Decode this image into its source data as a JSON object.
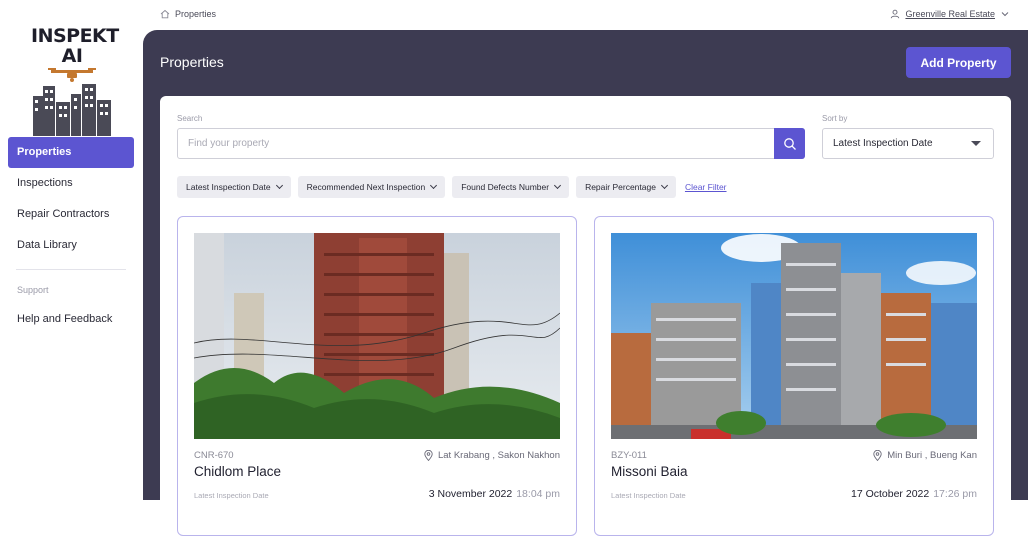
{
  "app": {
    "logo_text": "INSPEKT AI"
  },
  "sidebar": {
    "items": [
      {
        "label": "Properties"
      },
      {
        "label": "Inspections"
      },
      {
        "label": "Repair Contractors"
      },
      {
        "label": "Data Library"
      }
    ],
    "support_heading": "Support",
    "support_items": [
      {
        "label": "Help and Feedback"
      }
    ]
  },
  "topbar": {
    "breadcrumb": "Properties",
    "account_name": "Greenville Real Estate"
  },
  "main": {
    "title": "Properties",
    "add_button": "Add Property",
    "search": {
      "label": "Search",
      "placeholder": "Find your property",
      "value": ""
    },
    "sort": {
      "label": "Sort by",
      "value": "Latest Inspection Date"
    },
    "filters": [
      "Latest Inspection Date",
      "Recommended Next Inspection",
      "Found Defects Number",
      "Repair Percentage"
    ],
    "clear_filter": "Clear Filter",
    "properties": [
      {
        "code": "CNR-670",
        "location": "Lat Krabang , Sakon Nakhon",
        "name": "Chidlom Place",
        "inspection_label": "Latest Inspection Date",
        "inspection_date": "3 November 2022",
        "inspection_time": "18:04 pm"
      },
      {
        "code": "BZY-011",
        "location": "Min Buri , Bueng Kan",
        "name": "Missoni Baia",
        "inspection_label": "Latest Inspection Date",
        "inspection_date": "17 October 2022",
        "inspection_time": "17:26 pm"
      }
    ]
  },
  "colors": {
    "accent": "#5c55d1",
    "panel": "#3d3b52",
    "card_border": "#b9b4ec"
  }
}
